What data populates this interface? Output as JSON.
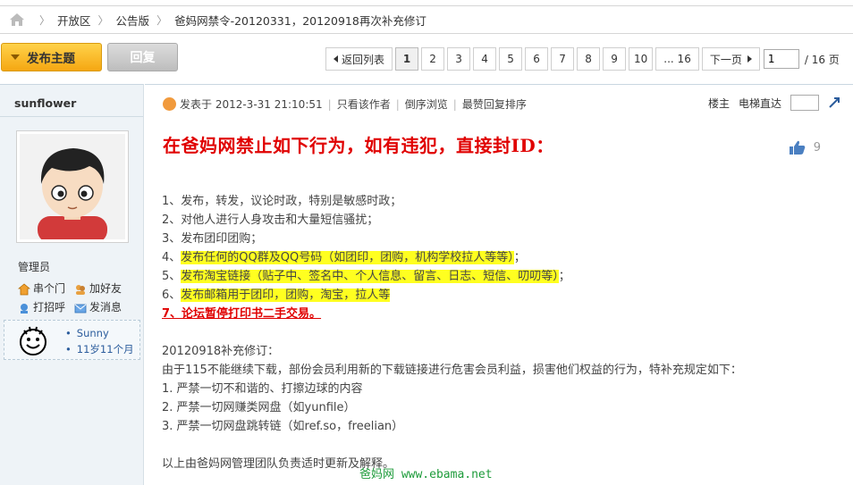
{
  "breadcrumb": {
    "items": [
      "开放区",
      "公告版",
      "爸妈网禁令-20120331，20120918再次补充修订"
    ]
  },
  "actions": {
    "post_label": "发布主题",
    "reply_label": "回复"
  },
  "pager": {
    "prev_label": "返回列表",
    "pages": [
      "1",
      "2",
      "3",
      "4",
      "5",
      "6",
      "7",
      "8",
      "9",
      "10"
    ],
    "ellipsis_label": "... 16",
    "next_label": "下一页",
    "input_value": "1",
    "total_label": "/ 16 页"
  },
  "author": {
    "name": "sunflower",
    "role": "管理员",
    "links": [
      "串个门",
      "加好友",
      "打招呼",
      "发消息"
    ],
    "medal_lines": [
      "Sunny",
      "11岁11个月"
    ]
  },
  "post": {
    "posted_at": "发表于 2012-3-31 21:10:51",
    "only_author": "只看该作者",
    "reverse": "倒序浏览",
    "hot_sort": "最赞回复排序",
    "floor_label": "楼主",
    "jump_label": "电梯直达",
    "headline": "在爸妈网禁止如下行为，如有违犯，直接封ID：",
    "like_count": "9",
    "rules": [
      "1、发布，转发，议论时政，特别是敏感时政；",
      "2、对他人进行人身攻击和大量短信骚扰；",
      "3、发布团印团购；"
    ],
    "rule4_prefix": "4、",
    "rule4_hl": "发布任何的QQ群及QQ号码（如团印，团购，机构学校拉人等等）",
    "rule4_suffix": "；",
    "rule5_prefix": "5、",
    "rule5_hl": "发布淘宝链接（贴子中、签名中、个人信息、留言、日志、短信、叨叨等）",
    "rule5_suffix": "；",
    "rule6_prefix": "6、",
    "rule6_hl": "发布邮箱用于团印，团购，淘宝，拉人等",
    "rule7": "7、论坛暂停打印书二手交易。",
    "supp_title": "20120918补充修订：",
    "supp_intro": "由于115不能继续下载，部份会员利用新的下载链接进行危害会员利益，损害他们权益的行为，特补充规定如下：",
    "supp_items": [
      "1. 严禁一切不和谐的、打擦边球的内容",
      "2. 严禁一切网赚类网盘（如yunfile）",
      "3. 严禁一切网盘跳转链（如ref.so，freelian）"
    ],
    "footer_note": "以上由爸妈网管理团队负责适时更新及解释。"
  },
  "watermark": "爸妈网 www.ebama.net",
  "colors": {
    "headline_red": "#e00000",
    "highlight_yellow": "#ffff20",
    "post_button": "#f5a712",
    "watermark_green": "#1d9b3a"
  }
}
